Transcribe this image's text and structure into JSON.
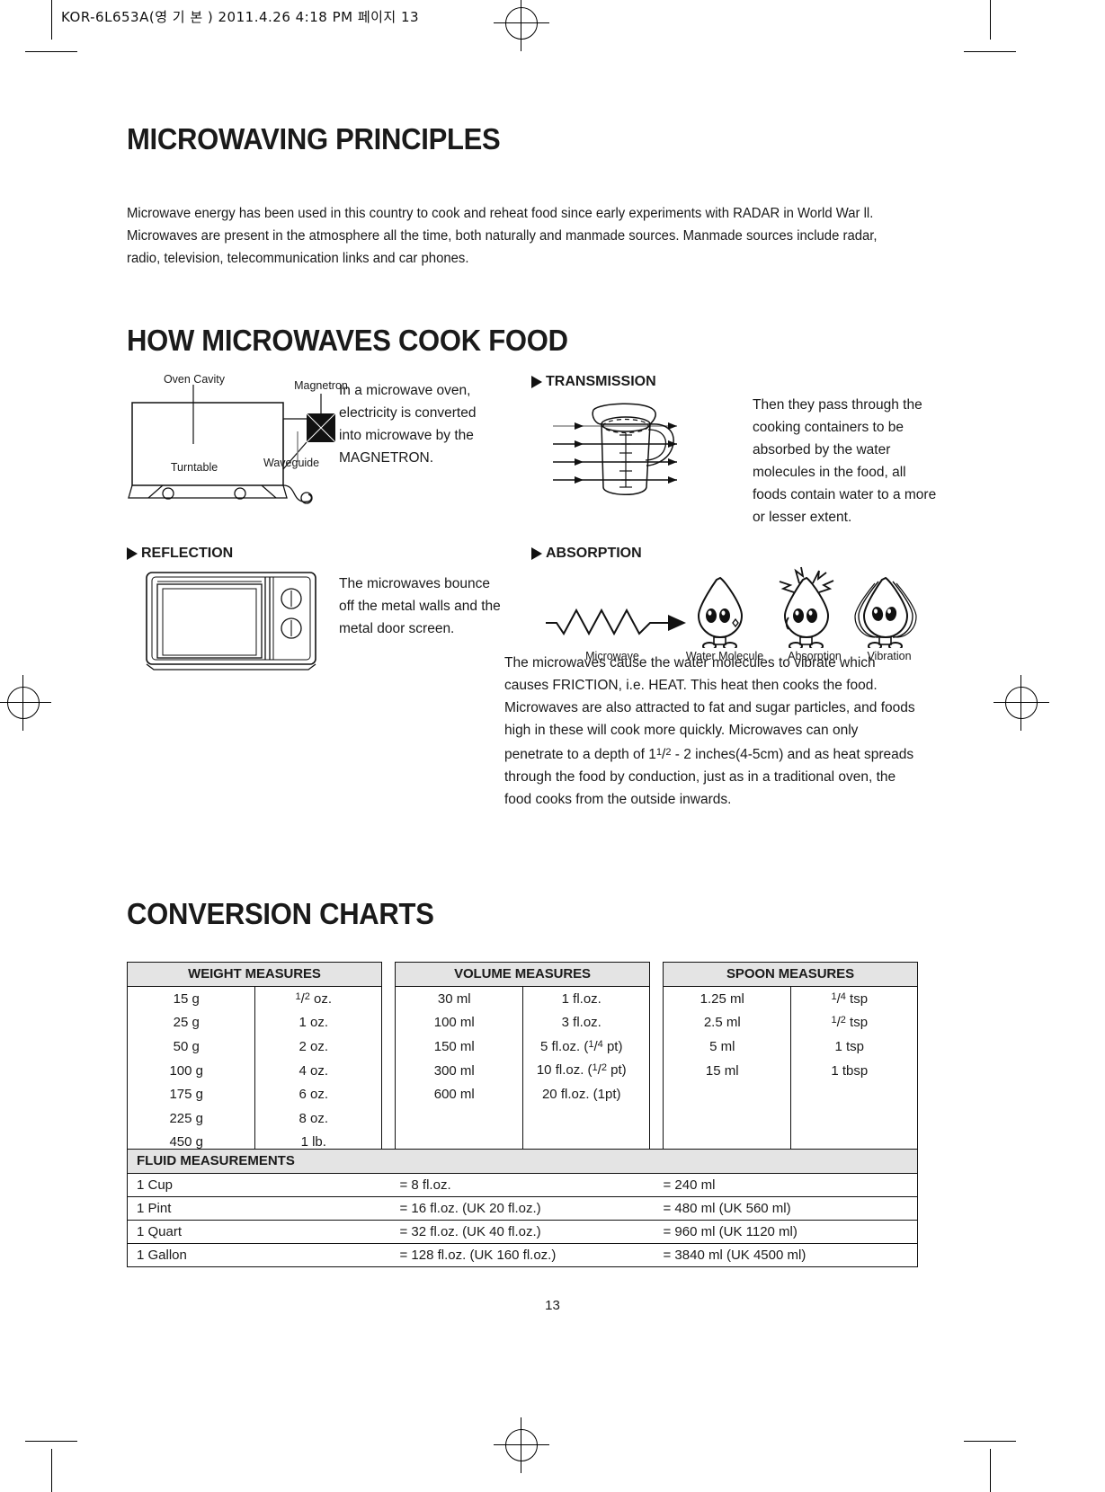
{
  "slug": "KOR-6L653A(영 기 본 )  2011.4.26 4:18 PM  페이지 13",
  "page_number": "13",
  "sections": {
    "principles": {
      "title": "MICROWAVING PRINCIPLES",
      "paragraph": "Microwave energy has been used in this country to cook and reheat food since early experiments with RADAR in World War ll. Microwaves are present in the atmosphere all the time, both naturally and manmade sources. Manmade sources include radar, radio, television, telecommunication links and car phones."
    },
    "how": {
      "title": "HOW MICROWAVES COOK FOOD",
      "oven_diagram": {
        "labels": {
          "oven_cavity": "Oven Cavity",
          "magnetron": "Magnetron",
          "turntable": "Turntable",
          "waveguide": "Waveguide"
        }
      },
      "magnetron_text": "In a microwave oven, electricity is converted into microwave by the MAGNETRON.",
      "transmission": {
        "heading": "TRANSMISSION",
        "text": "Then they pass through the cooking containers to be absorbed by the water molecules in the food, all foods contain water to a more or lesser extent."
      },
      "reflection": {
        "heading": "REFLECTION",
        "text": "The microwaves bounce off the metal walls and the metal door screen."
      },
      "absorption": {
        "heading": "ABSORPTION",
        "captions": {
          "microwave": "Microwave",
          "water_molecule": "Water Molecule",
          "absorption": "Absorption",
          "vibration": "Vibration"
        },
        "text_part1": "The microwaves cause the water molecules to vibrate which causes FRICTION, i.e. HEAT. This heat then cooks the food. Microwaves are also attracted to fat and sugar particles, and foods high in these will cook more quickly. Microwaves can only penetrate to a depth of 1",
        "text_frac_n": "1",
        "text_frac_d": "2",
        "text_part2": " - 2 inches(4-5cm) and as heat spreads through the food by conduction, just as in a traditional oven, the food cooks from the outside inwards."
      }
    },
    "conversion": {
      "title": "CONVERSION CHARTS",
      "weight": {
        "header": "WEIGHT MEASURES",
        "rows": [
          {
            "metric": "15 g",
            "imperial_n": "1",
            "imperial_d": "2",
            "imperial": " oz."
          },
          {
            "metric": "25 g",
            "imperial": "1 oz."
          },
          {
            "metric": "50 g",
            "imperial": "2 oz."
          },
          {
            "metric": "100 g",
            "imperial": "4 oz."
          },
          {
            "metric": "175 g",
            "imperial": "6 oz."
          },
          {
            "metric": "225 g",
            "imperial": "8 oz."
          },
          {
            "metric": "450 g",
            "imperial": "1 lb."
          }
        ]
      },
      "volume": {
        "header": "VOLUME MEASURES",
        "rows": [
          {
            "metric": "30 ml",
            "imperial": "1 fl.oz."
          },
          {
            "metric": "100 ml",
            "imperial": "3 fl.oz."
          },
          {
            "metric": "150 ml",
            "imperial_pre": "5 fl.oz. (",
            "imperial_n": "1",
            "imperial_d": "4",
            "imperial_post": " pt)"
          },
          {
            "metric": "300 ml",
            "imperial_pre": "10 fl.oz. (",
            "imperial_n": "1",
            "imperial_d": "2",
            "imperial_post": " pt)"
          },
          {
            "metric": "600 ml",
            "imperial": "20 fl.oz. (1pt)"
          }
        ]
      },
      "spoon": {
        "header": "SPOON MEASURES",
        "rows": [
          {
            "metric": "1.25 ml",
            "imperial_n": "1",
            "imperial_d": "4",
            "imperial": " tsp"
          },
          {
            "metric": "2.5 ml",
            "imperial_n": "1",
            "imperial_d": "2",
            "imperial": " tsp"
          },
          {
            "metric": "5 ml",
            "imperial": "1 tsp"
          },
          {
            "metric": "15 ml",
            "imperial": "1 tbsp"
          }
        ]
      },
      "fluid": {
        "header": "FLUID MEASUREMENTS",
        "rows": [
          {
            "unit": "1 Cup",
            "oz": "= 8 fl.oz.",
            "ml": "= 240 ml"
          },
          {
            "unit": "1 Pint",
            "oz": "= 16 fl.oz. (UK 20 fl.oz.)",
            "ml": "= 480 ml (UK 560 ml)"
          },
          {
            "unit": "1 Quart",
            "oz": "= 32 fl.oz. (UK 40 fl.oz.)",
            "ml": "= 960 ml (UK 1120 ml)"
          },
          {
            "unit": "1 Gallon",
            "oz": "= 128 fl.oz. (UK 160 fl.oz.)",
            "ml": "= 3840 ml (UK 4500 ml)"
          }
        ]
      }
    }
  }
}
